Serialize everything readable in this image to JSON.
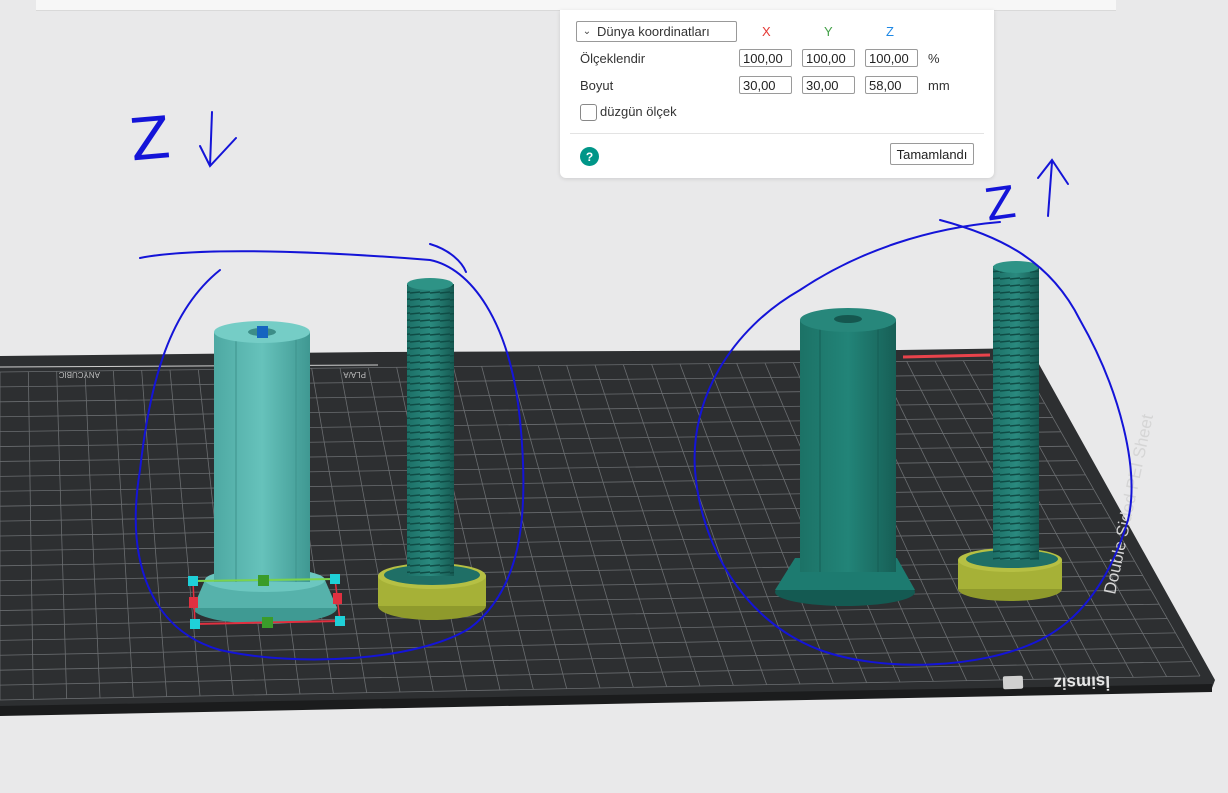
{
  "scale_panel": {
    "coord_mode": "Dünya koordinatları",
    "axes": {
      "x": "X",
      "y": "Y",
      "z": "Z"
    },
    "axis_colors": {
      "x": "#e53935",
      "y": "#43a047",
      "z": "#1e88e5"
    },
    "rows": {
      "scale": {
        "label": "Ölçeklendir",
        "x": "100,00",
        "y": "100,00",
        "z": "100,00",
        "unit": "%"
      },
      "size": {
        "label": "Boyut",
        "x": "30,00",
        "y": "30,00",
        "z": "58,00",
        "unit": "mm"
      }
    },
    "uniform_label": "düzgün ölçek",
    "uniform_checked": false,
    "help_icon": "question-icon",
    "help_glyph": "?",
    "done_label": "Tamamlandı"
  },
  "bed": {
    "sheet_label": "Double Sided PEI Sheet",
    "plate_name": "İsimsiz",
    "corner_label_left": "PLA/A",
    "corner_label_back": "ANYCUBIC"
  },
  "annotations": {
    "left_mark": "Z",
    "right_mark": "Z"
  },
  "colors": {
    "model_selected": "#5cb8b2",
    "model": "#1f7f73",
    "support_yellow": "#a9b33a",
    "bed": "#2f3133",
    "pen_blue": "#1414d8"
  }
}
